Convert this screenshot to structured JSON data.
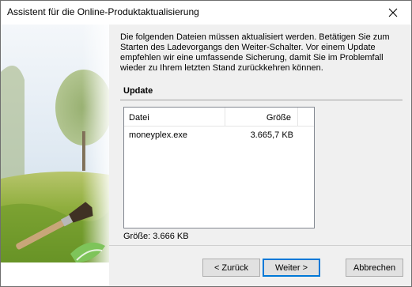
{
  "window": {
    "title": "Assistent für die Online-Produktaktualisierung",
    "close_icon": "close-icon"
  },
  "main": {
    "description": "Die folgenden Dateien müssen aktualisiert werden. Betätigen Sie zum Starten des Ladevorgangs den Weiter-Schalter. Vor einem Update empfehlen wir eine umfassende Sicherung, damit Sie im Problemfall wieder zu Ihrem letzten Stand zurückkehren können.",
    "section_title": "Update",
    "list": {
      "columns": [
        "Datei",
        "Größe"
      ],
      "rows": [
        {
          "name": "moneyplex.exe",
          "size": "3.665,7 KB"
        }
      ]
    },
    "total_size": "Größe: 3.666 KB"
  },
  "buttons": {
    "back": "< Zurück",
    "next": "Weiter >",
    "cancel": "Abbrechen"
  }
}
